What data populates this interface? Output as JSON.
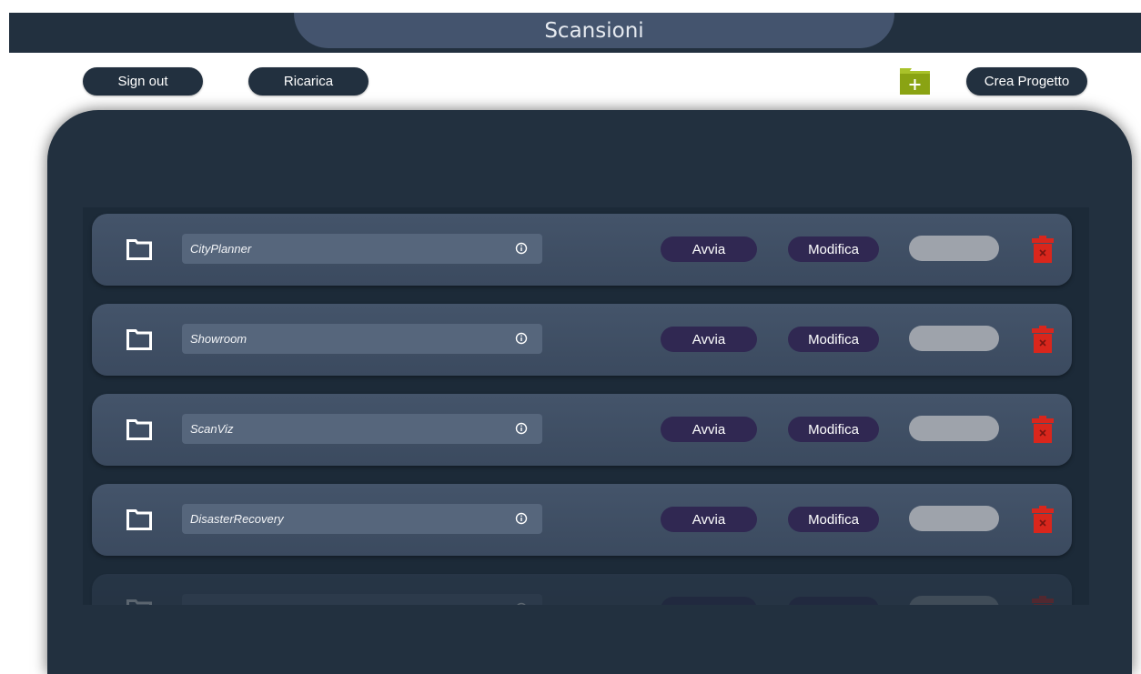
{
  "header": {
    "title": "Scansioni"
  },
  "toolbar": {
    "sign_out_label": "Sign out",
    "reload_label": "Ricarica",
    "create_project_label": "Crea Progetto",
    "add_folder_icon": "folder-plus-icon"
  },
  "colors": {
    "topbar": "#22303f",
    "title_pill": "#44546e",
    "panel": "#22303f",
    "row": "#44546a",
    "name_box": "#56667c",
    "action_pill": "#302852",
    "trash": "#d9261c",
    "add_folder": "#8aa313"
  },
  "projects": [
    {
      "name": "CityPlanner",
      "start_label": "Avvia",
      "edit_label": "Modifica"
    },
    {
      "name": "Showroom",
      "start_label": "Avvia",
      "edit_label": "Modifica"
    },
    {
      "name": "ScanViz",
      "start_label": "Avvia",
      "edit_label": "Modifica"
    },
    {
      "name": "DisasterRecovery",
      "start_label": "Avvia",
      "edit_label": "Modifica"
    },
    {
      "name": "",
      "start_label": "",
      "edit_label": ""
    }
  ]
}
